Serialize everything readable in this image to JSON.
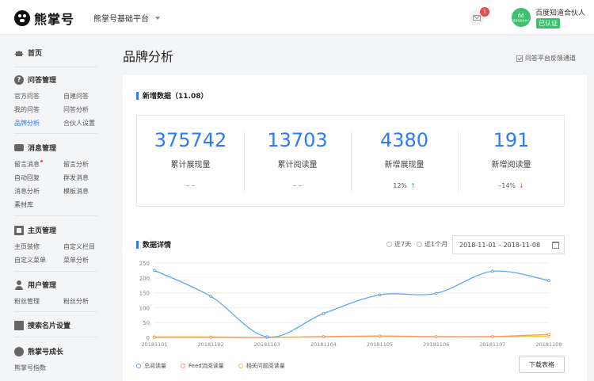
{
  "header": {
    "logo_text": "熊掌号",
    "platform": "熊掌号基础平台",
    "notification_count": "1",
    "avatar_text": "ôô",
    "avatar_sub": "百度知道合伙人",
    "partner_name": "百度知道合伙人",
    "verified_label": "已认证"
  },
  "sidebar": {
    "home": "首页",
    "sections": [
      {
        "title": "问答管理",
        "icon": "question-icon",
        "items": [
          "官方问答",
          "自建问答",
          "我的问答",
          "问答分析",
          "品牌分析",
          "合伙人设置"
        ]
      },
      {
        "title": "消息管理",
        "icon": "message-icon",
        "items": [
          "留言消息",
          "留言分析",
          "自动回复",
          "群发消息",
          "消息分析",
          "模板消息",
          "素材库"
        ]
      },
      {
        "title": "主页管理",
        "icon": "homepage-icon",
        "items": [
          "主页装修",
          "自定义栏目",
          "自定义菜单",
          "菜单分析"
        ]
      },
      {
        "title": "用户管理",
        "icon": "user-icon",
        "items": [
          "粉丝管理",
          "粉丝分析"
        ]
      },
      {
        "title": "搜索名片设置",
        "icon": "card-icon",
        "items": []
      },
      {
        "title": "熊掌号成长",
        "icon": "growth-icon",
        "items": [
          "熊掌号指数"
        ]
      }
    ],
    "active_item": "品牌分析"
  },
  "main": {
    "title": "品牌分析",
    "feedback": "问答平台反馈通道",
    "new_data_title": "新增数据（11.08）",
    "stats": [
      {
        "value": "375742",
        "label": "累计展现量",
        "trend": "– –",
        "dir": ""
      },
      {
        "value": "13703",
        "label": "累计阅读量",
        "trend": "– –",
        "dir": ""
      },
      {
        "value": "4380",
        "label": "新增展现量",
        "trend": "12%",
        "dir": "up"
      },
      {
        "value": "191",
        "label": "新增阅读量",
        "trend": "–14%",
        "dir": "down"
      }
    ],
    "detail_title": "数据详情",
    "range_options": [
      "近7天",
      "近1个月"
    ],
    "date_range": "2018-11-01  –  2018-11-08",
    "download_label": "下载表格"
  },
  "chart_data": {
    "type": "line",
    "x": [
      "20181101",
      "20181102",
      "20181103",
      "20181104",
      "20181105",
      "20181106",
      "20181107",
      "20181108"
    ],
    "ylim": [
      0,
      250
    ],
    "yticks": [
      0,
      50,
      100,
      150,
      200,
      250
    ],
    "grid": true,
    "legend_position": "bottom-left",
    "series": [
      {
        "name": "总阅读量",
        "color": "#5aa7f5",
        "values": [
          225,
          138,
          2,
          80,
          143,
          148,
          222,
          191
        ]
      },
      {
        "name": "Feed流阅读量",
        "color": "#f39a6a",
        "values": [
          0,
          0,
          0,
          3,
          5,
          3,
          3,
          10
        ]
      },
      {
        "name": "相关问题阅读量",
        "color": "#f2c744",
        "values": [
          2,
          2,
          0,
          2,
          4,
          2,
          3,
          4
        ]
      }
    ]
  }
}
